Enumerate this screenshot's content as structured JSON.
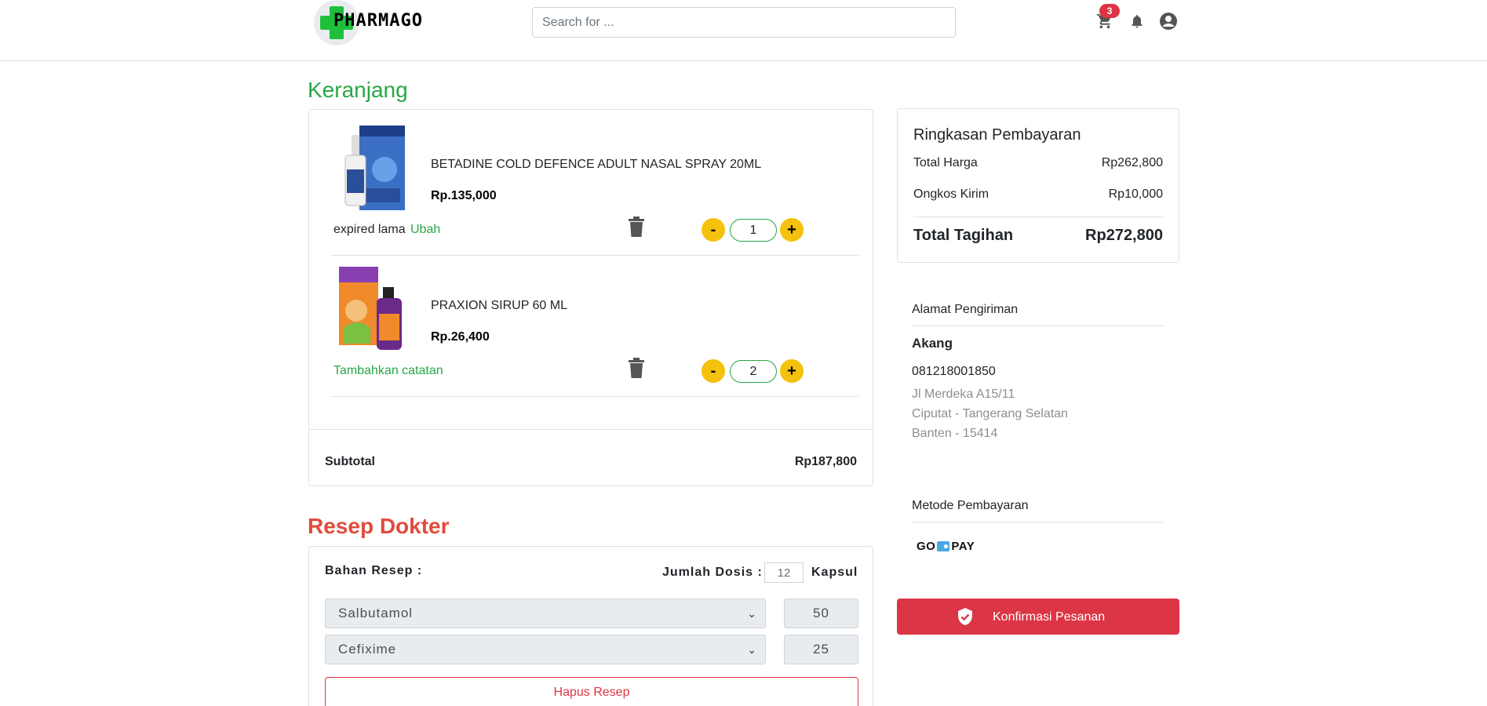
{
  "header": {
    "logo_text": "PHARMAGO",
    "search_placeholder": "Search for ...",
    "cart_count": "3",
    "icons": [
      "cart-icon",
      "bell-icon",
      "account-icon"
    ]
  },
  "cart": {
    "title": "Keranjang",
    "items": [
      {
        "name": "BETADINE COLD DEFENCE ADULT NASAL SPRAY 20ML",
        "price": "Rp.135,000",
        "note": "expired lama",
        "note_action": "Ubah",
        "quantity": "1"
      },
      {
        "name": "PRAXION SIRUP 60 ML",
        "price": "Rp.26,400",
        "note": "",
        "note_action": "Tambahkan catatan",
        "quantity": "2"
      }
    ],
    "qty_minus": "-",
    "qty_plus": "+",
    "subtotal_label": "Subtotal",
    "subtotal_value": "Rp187,800"
  },
  "resep": {
    "title": "Resep Dokter",
    "bahan_label": "Bahan Resep :",
    "dosis_label": "Jumlah Dosis :",
    "dosis_value": "12",
    "unit_label": "Kapsul",
    "ingredients": [
      {
        "name": "Salbutamol",
        "amount": "50"
      },
      {
        "name": "Cefixime",
        "amount": "25"
      }
    ],
    "delete_button": "Hapus Resep"
  },
  "summary": {
    "title": "Ringkasan Pembayaran",
    "total_harga_label": "Total Harga",
    "total_harga_value": "Rp262,800",
    "ongkir_label": "Ongkos Kirim",
    "ongkir_value": "Rp10,000",
    "total_tagihan_label": "Total Tagihan",
    "total_tagihan_value": "Rp272,800"
  },
  "address": {
    "title": "Alamat Pengiriman",
    "name": "Akang",
    "phone": "081218001850",
    "lines": [
      "Jl Merdeka A15/11",
      "Ciputat - Tangerang Selatan",
      "Banten - 15414"
    ]
  },
  "payment": {
    "title": "Metode Pembayaran",
    "method_left": "GO",
    "method_right": "PAY"
  },
  "confirm_button": "Konfirmasi Pesanan",
  "colors": {
    "green": "#28a745",
    "red": "#dc3545",
    "heading_red": "#e04b3c",
    "yellow": "#f4c20d"
  }
}
